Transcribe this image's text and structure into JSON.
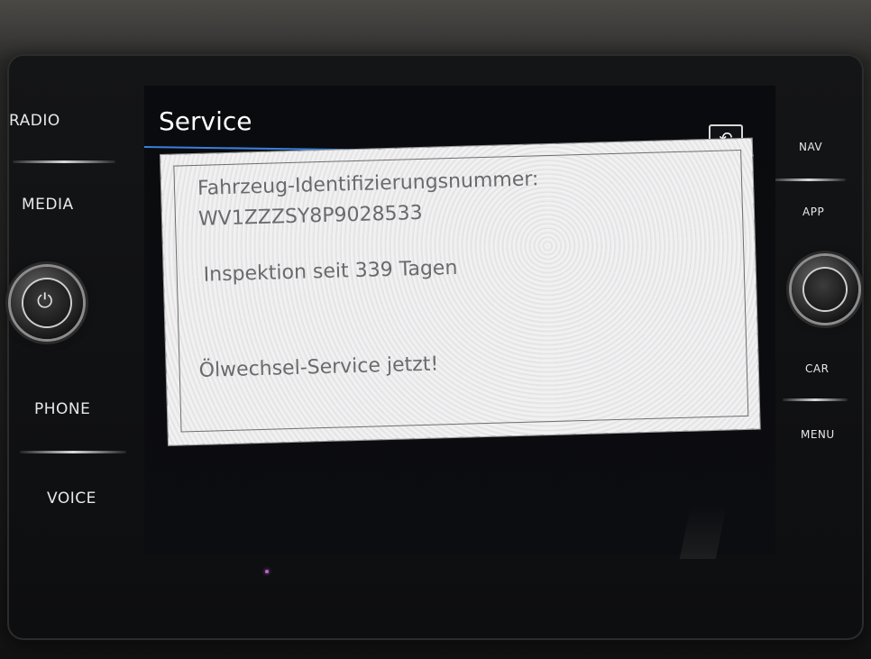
{
  "left_buttons": {
    "radio": "RADIO",
    "media": "MEDIA",
    "phone": "PHONE",
    "voice": "VOICE"
  },
  "right_buttons": {
    "nav": "NAV",
    "app": "APP",
    "car": "CAR",
    "menu": "MENU"
  },
  "header": {
    "title": "Service",
    "back_icon": "back-arrow-icon"
  },
  "service_info": {
    "vin_label": "Fahrzeug-Identifizierungsnummer:",
    "vin_value": "WV1ZZZSY8P9028533",
    "inspection_text": "Inspektion seit 339 Tagen",
    "oil_service_text": "Ölwechsel-Service jetzt!"
  },
  "colors": {
    "accent": "#3a7fd9",
    "screen_background": "#0a0b0e",
    "label_text": "#e8e8ea"
  },
  "icons": {
    "power_knob": "power-icon",
    "back": "back-arrow-icon"
  }
}
